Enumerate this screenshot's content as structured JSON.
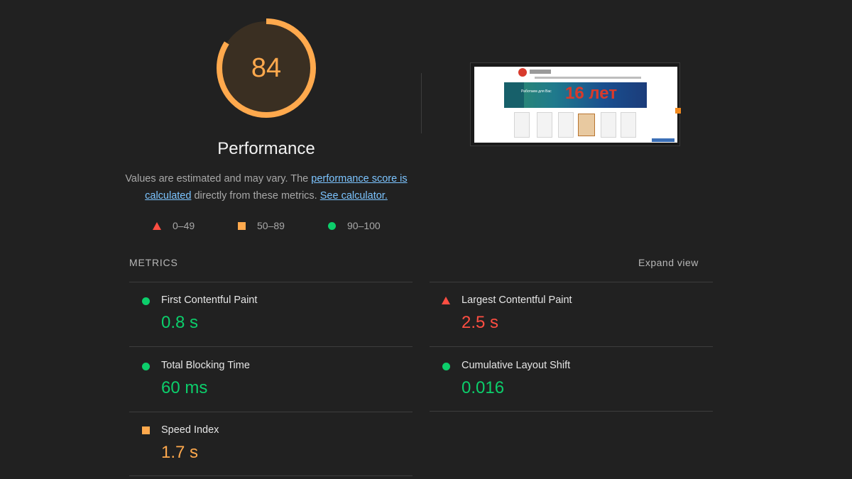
{
  "score": {
    "value": "84",
    "fraction": 0.84,
    "color": "#ffa94d",
    "track_color": "#3a2f22",
    "title": "Performance"
  },
  "description": {
    "text_1": "Values are estimated and may vary. The ",
    "link_1": "performance score is calculated",
    "text_2": " directly from these metrics. ",
    "link_2": "See calculator."
  },
  "legend": [
    {
      "range": "0–49",
      "icon": "triangle-icon",
      "color": "#ff4e42"
    },
    {
      "range": "50–89",
      "icon": "square-icon",
      "color": "#ffa94d"
    },
    {
      "range": "90–100",
      "icon": "circle-icon",
      "color": "#0cce6b"
    }
  ],
  "screenshot": {
    "banner_text_small": "Работаем для Вас",
    "banner_text_big": "16 лет"
  },
  "metrics": {
    "label": "METRICS",
    "expand_label": "Expand view",
    "items": [
      {
        "name": "First Contentful Paint",
        "value": "0.8 s",
        "status": "good",
        "icon": "circle-icon"
      },
      {
        "name": "Largest Contentful Paint",
        "value": "2.5 s",
        "status": "poor",
        "icon": "triangle-icon"
      },
      {
        "name": "Total Blocking Time",
        "value": "60 ms",
        "status": "good",
        "icon": "circle-icon"
      },
      {
        "name": "Cumulative Layout Shift",
        "value": "0.016",
        "status": "good",
        "icon": "circle-icon"
      },
      {
        "name": "Speed Index",
        "value": "1.7 s",
        "status": "average",
        "icon": "square-icon"
      }
    ]
  },
  "colors": {
    "good": "#0cce6b",
    "average": "#ffa94d",
    "poor": "#ff4e42",
    "background": "#212121"
  }
}
